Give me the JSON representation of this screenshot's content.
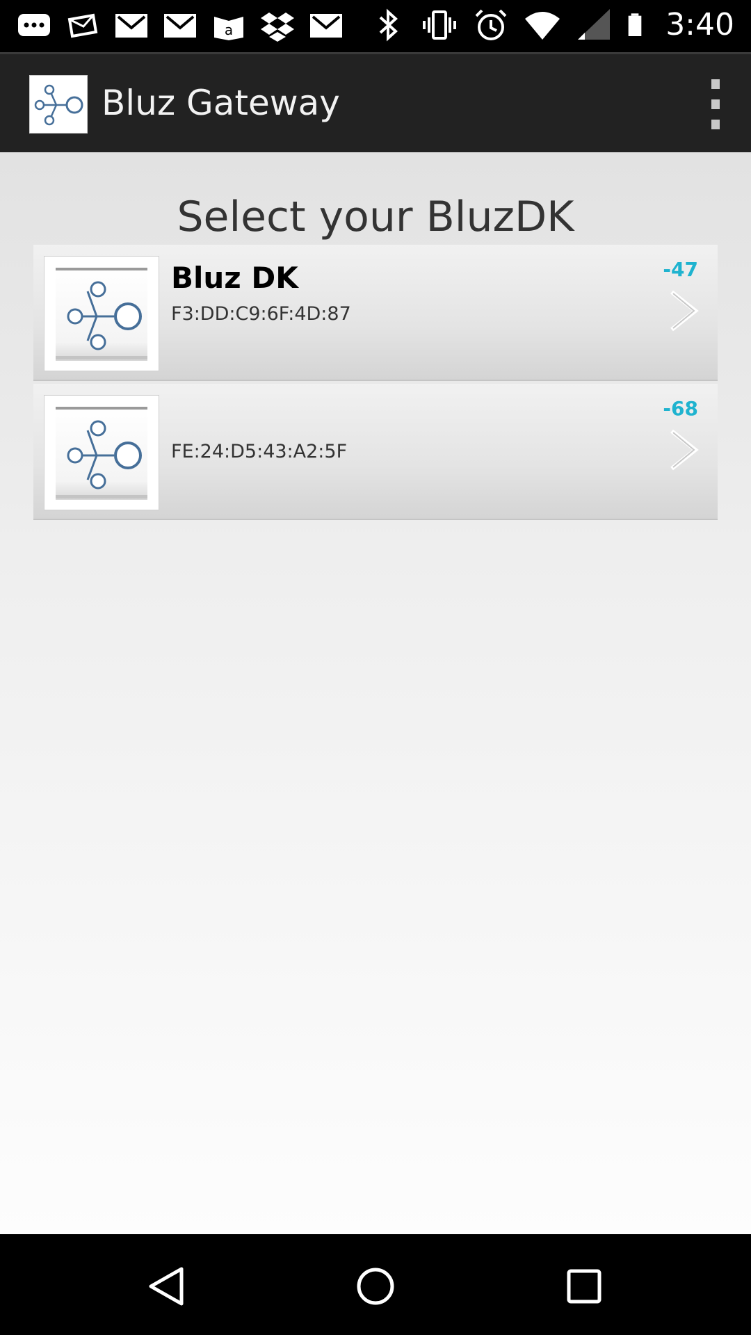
{
  "status_bar": {
    "time": "3:40",
    "left_icons": [
      "messaging-icon",
      "email-icon",
      "gmail-icon",
      "gmail-icon",
      "amazon-kindle-icon",
      "dropbox-icon",
      "gmail-icon"
    ],
    "right_icons": [
      "bluetooth-icon",
      "vibrate-icon",
      "alarm-icon",
      "wifi-icon",
      "cell-signal-icon",
      "battery-icon"
    ]
  },
  "action_bar": {
    "title": "Bluz Gateway",
    "overflow_icon": "overflow-menu-icon"
  },
  "page": {
    "heading": "Select your BluzDK"
  },
  "devices": [
    {
      "name": "Bluz DK",
      "mac": "F3:DD:C9:6F:4D:87",
      "rssi": "-47"
    },
    {
      "name": "",
      "mac": "FE:24:D5:43:A2:5F",
      "rssi": "-68"
    }
  ],
  "nav_bar": {
    "buttons": [
      "back-icon",
      "home-icon",
      "recent-apps-icon"
    ]
  },
  "colors": {
    "rssi": "#1fb3cf",
    "action_bar": "#222222",
    "status_bar": "#000000"
  }
}
